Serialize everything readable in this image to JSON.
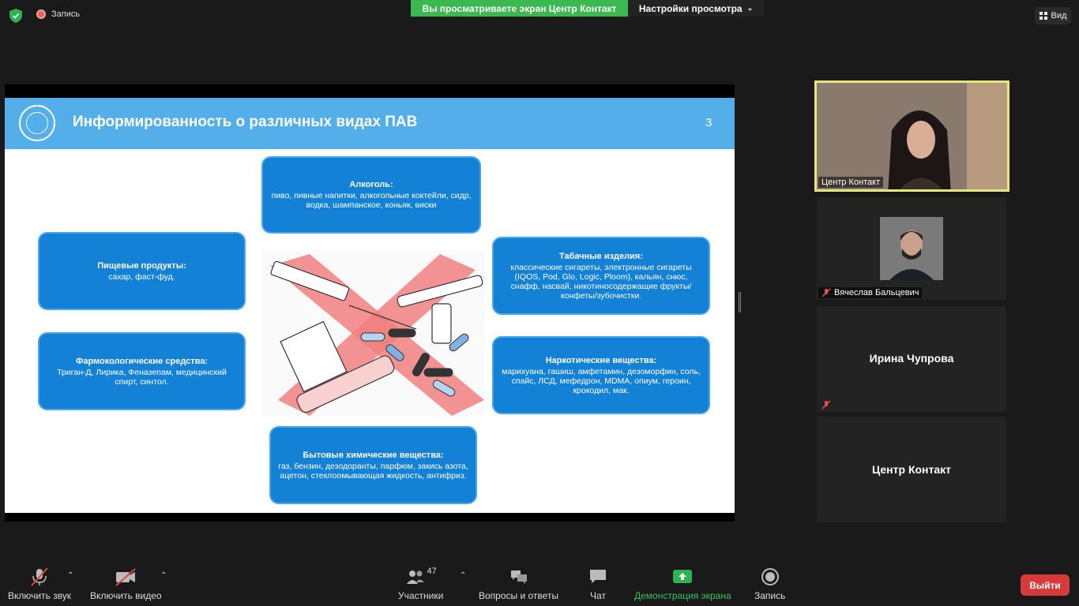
{
  "top": {
    "recording_label": "Запись",
    "share_banner": "Вы просматриваете экран Центр Контакт",
    "view_settings": "Настройки просмотра",
    "view_label": "Вид"
  },
  "slide": {
    "title": "Информированность о различных видах ПАВ",
    "page_number": "3",
    "boxes": {
      "alcohol": {
        "title": "Алкоголь:",
        "text": "пиво, пивные напитки, алкогольные коктейли, сидр, водка, шампанское, коньяк, виски"
      },
      "food": {
        "title": "Пищевые продукты:",
        "text": "сахар, фаст-фуд."
      },
      "tobacco": {
        "title": "Табачные изделия:",
        "text": "классические сигареты, электронные сигареты (IQOS, Pod, Glo, Logic, Ploom), кальян, снюс, снафф, насвай, никотиносодержащие фрукты/конфеты/зубочистки."
      },
      "pharma": {
        "title": "Фармокологические средства:",
        "text": "Триган-Д, Лирика, Феназепам, медицинский спирт, синтол."
      },
      "narcotic": {
        "title": "Наркотические вещества:",
        "text": "марихуана, гашиш, амфетамин, дезоморфин, соль, спайс, ЛСД, мефедрон, MDMA, опиум, героин, крокодил, мак."
      },
      "household": {
        "title": "Бытовые химические вещества:",
        "text": "газ, бензин, дезодоранты, парфюм, закись азота, ацетон, стеклоомывающая жидкость, антифриз."
      }
    }
  },
  "participants": [
    {
      "name": "Центр Контакт"
    },
    {
      "name": "Вячеслав Бальцевич"
    },
    {
      "name": "Ирина Чупрова"
    },
    {
      "name": "Центр Контакт"
    }
  ],
  "toolbar": {
    "mute_label": "Включить звук",
    "video_label": "Включить видео",
    "participants_label": "Участники",
    "participants_count": "47",
    "qa_label": "Вопросы и ответы",
    "chat_label": "Чат",
    "share_label": "Демонстрация экрана",
    "record_label": "Запись",
    "leave_label": "Выйти"
  },
  "colors": {
    "share_green": "#3cb850",
    "slide_header": "#54aeea",
    "box_blue": "#1381d6",
    "leave_red": "#d63a3a",
    "active_speaker_border": "#e6e67a"
  }
}
